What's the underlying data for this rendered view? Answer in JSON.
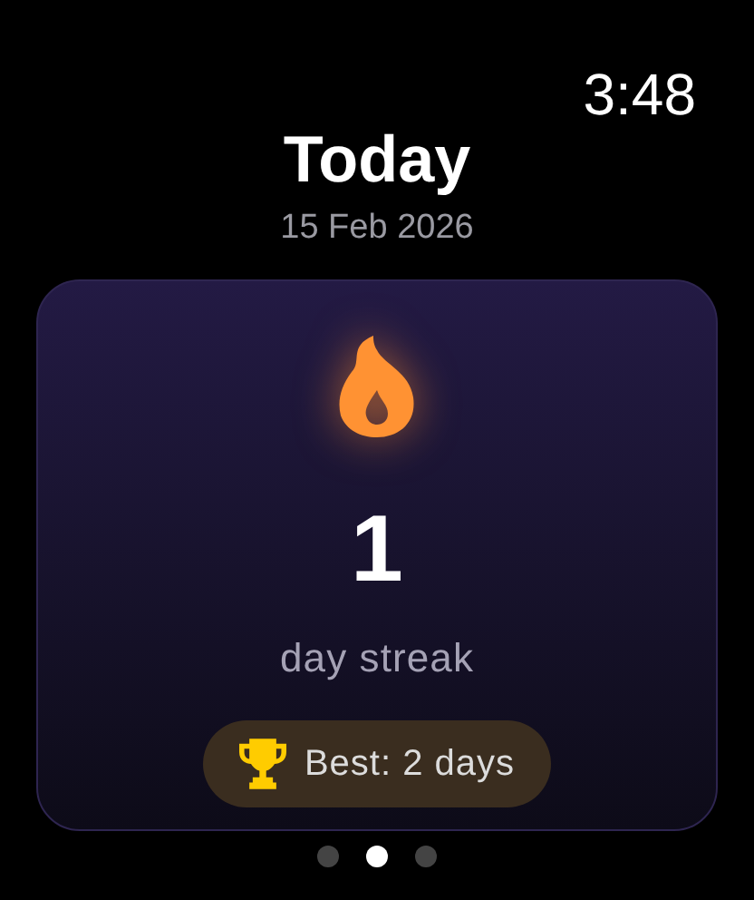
{
  "status_bar": {
    "time": "3:48"
  },
  "header": {
    "title": "Today",
    "date": "15 Feb 2026"
  },
  "streak_card": {
    "count": "1",
    "label": "day streak",
    "best": "Best: 2 days"
  },
  "page_dots": [
    {
      "selected": false
    },
    {
      "selected": true
    },
    {
      "selected": false
    }
  ]
}
